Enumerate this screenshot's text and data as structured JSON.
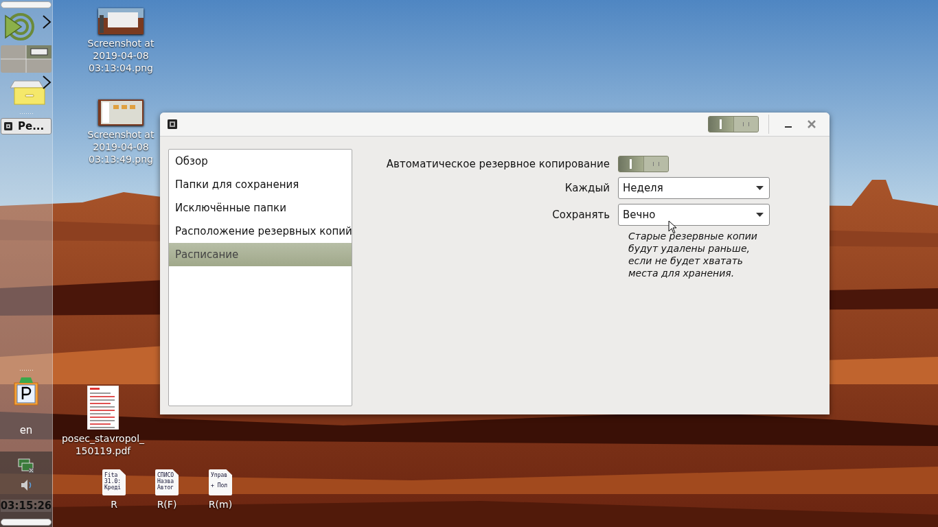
{
  "panel": {
    "launchers": [
      {
        "kind": "menu"
      },
      {
        "kind": "workspaces"
      },
      {
        "kind": "files"
      }
    ],
    "tasks": [
      {
        "label": "Ре...",
        "selected": true
      }
    ],
    "tray_launcher": {
      "kind": "parking"
    },
    "keyboard_layout": "en",
    "clock": "03:15:26"
  },
  "desktop_icons": [
    {
      "kind": "screenshot",
      "label_lines": [
        "Screenshot at",
        "2019-04-08",
        "03:13:04.png"
      ]
    },
    {
      "kind": "screenshot",
      "label_lines": [
        "Screenshot at",
        "2019-04-08",
        "03:13:49.png"
      ]
    },
    {
      "kind": "pdf",
      "label_lines": [
        "posec_stavropol_",
        "150119.pdf"
      ]
    },
    {
      "kind": "text",
      "label_lines": [
        "R"
      ],
      "preview": [
        "Fita",
        "31.0:",
        "Креді"
      ]
    },
    {
      "kind": "text",
      "label_lines": [
        "R(F)"
      ],
      "preview": [
        "СПИСО",
        "Назва",
        "Автог"
      ]
    },
    {
      "kind": "text",
      "label_lines": [
        "R(m)"
      ],
      "preview": [
        "Управ",
        "+ Пол"
      ]
    }
  ],
  "window": {
    "header_switch": {
      "on": true
    },
    "sidebar": [
      {
        "label": "Обзор",
        "selected": false
      },
      {
        "label": "Папки для сохранения",
        "selected": false
      },
      {
        "label": "Исключённые папки",
        "selected": false
      },
      {
        "label": "Расположение резервных копий",
        "selected": false
      },
      {
        "label": "Расписание",
        "selected": true
      }
    ],
    "settings": [
      {
        "kind": "switch",
        "label": "Автоматическое резервное копирование",
        "on": true
      },
      {
        "kind": "dropdown",
        "label": "Каждый",
        "value": "Неделя"
      },
      {
        "kind": "dropdown",
        "label": "Сохранять",
        "value": "Вечно"
      }
    ],
    "hint": "Старые резервные копии будут удалены раньше, если не будет хватать места для хранения."
  }
}
